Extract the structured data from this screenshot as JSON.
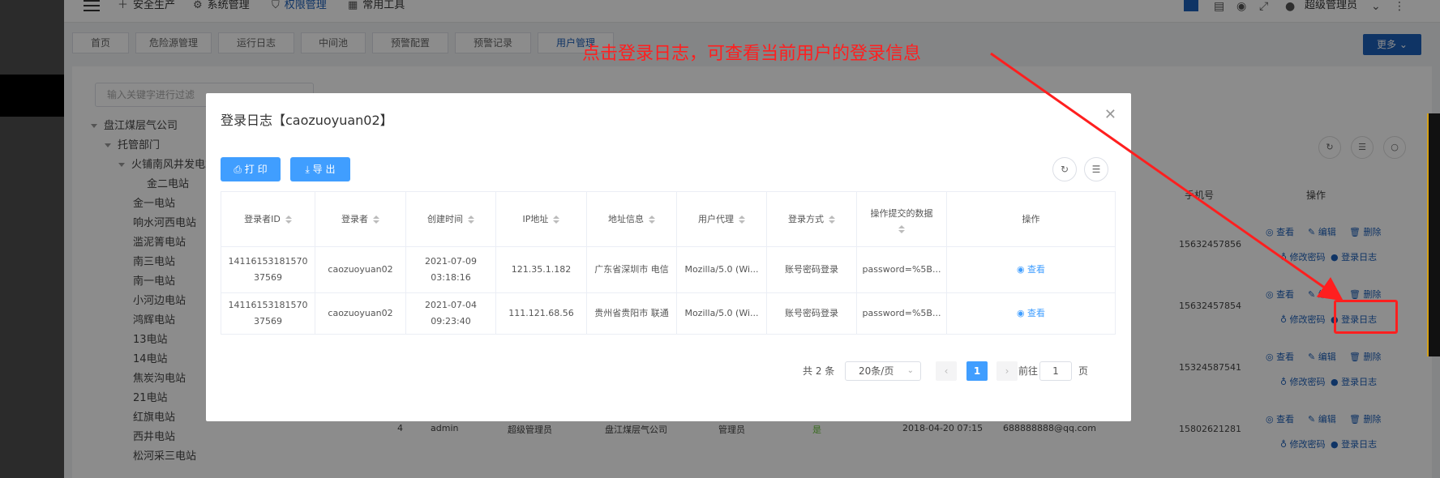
{
  "topnav": {
    "items": [
      {
        "label": "安全生产",
        "icon": "plus-icon"
      },
      {
        "label": "系统管理",
        "icon": "gear-icon"
      },
      {
        "label": "权限管理",
        "icon": "shield-icon"
      },
      {
        "label": "常用工具",
        "icon": "toolbox-icon"
      }
    ],
    "user": "超级管理员"
  },
  "tabs": [
    "首页",
    "危险源管理",
    "运行日志",
    "中间池",
    "预警配置",
    "预警记录",
    "用户管理"
  ],
  "more_label": "更多",
  "tree": {
    "search_placeholder": "输入关键字进行过滤",
    "nodes": [
      "盘江煤层气公司",
      "托管部门",
      "火铺南风井发电站",
      "金二电站",
      "金一电站",
      "响水河西电站",
      "滥泥箐电站",
      "南三电站",
      "南一电站",
      "小河边电站",
      "鸿辉电站",
      "13电站",
      "14电站",
      "焦炭沟电站",
      "21电站",
      "红旗电站",
      "西井电站",
      "松河采三电站"
    ]
  },
  "background_table": {
    "headers": {
      "phone": "手机号",
      "actions": "操作"
    },
    "phones": [
      "15632457856",
      "15632457854",
      "15324587541",
      "15802621281"
    ],
    "last_row": {
      "index": "4",
      "account": "admin",
      "role": "超级管理员",
      "company": "盘江煤层气公司",
      "dept": "管理员",
      "status": "是",
      "date": "2018-04-20 07:15",
      "email": "688888888@qq.com"
    },
    "actions": {
      "view": "查看",
      "edit": "编辑",
      "delete": "删除",
      "change_pwd": "修改密码",
      "login_log": "登录日志"
    }
  },
  "modal": {
    "title": "登录日志【caozuoyuan02】",
    "print_label": "打 印",
    "export_label": "导 出",
    "columns": [
      "登录者ID",
      "登录者",
      "创建时间",
      "IP地址",
      "地址信息",
      "用户代理",
      "登录方式",
      "操作提交的数据",
      "操作"
    ],
    "rows": [
      {
        "id": "1411615318157037569",
        "user": "caozuoyuan02",
        "time": "2021-07-09 03:18:16",
        "ip": "121.35.1.182",
        "location": "广东省深圳市 电信",
        "agent": "Mozilla/5.0 (Wi...",
        "method": "账号密码登录",
        "data": "password=%5B...",
        "action": "查看"
      },
      {
        "id": "1411615318157037569",
        "user": "caozuoyuan02",
        "time": "2021-07-04 09:23:40",
        "ip": "111.121.68.56",
        "location": "贵州省贵阳市 联通",
        "agent": "Mozilla/5.0 (Wi...",
        "method": "账号密码登录",
        "data": "password=%5B...",
        "action": "查看"
      }
    ],
    "pager": {
      "total": "共 2 条",
      "page_size": "20条/页",
      "current": "1",
      "goto_label": "前往",
      "goto_value": "1",
      "page_unit": "页"
    }
  },
  "annotation": {
    "text": "点击登录日志，可查看当前用户的登录信息",
    "color": "#ff1f1f"
  }
}
